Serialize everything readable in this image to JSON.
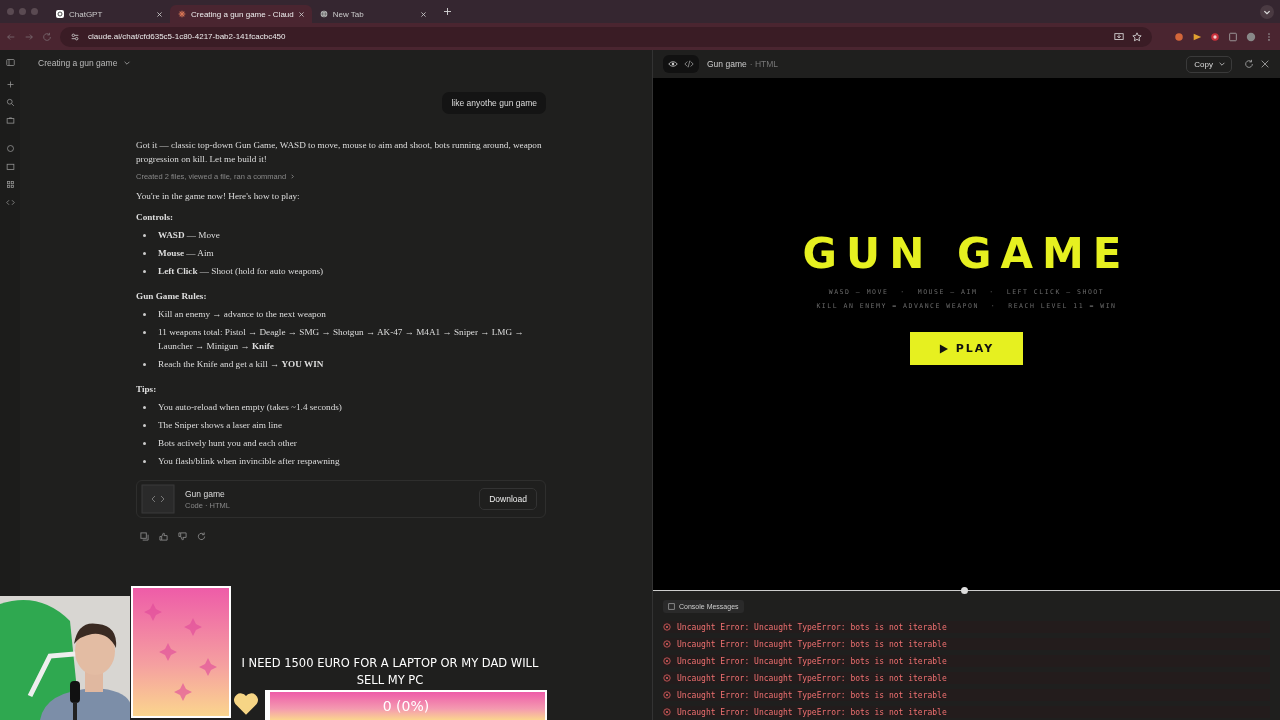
{
  "browser": {
    "tabs": [
      {
        "label": "ChatGPT",
        "kind": "chatgpt",
        "selected": false
      },
      {
        "label": "Creating a gun game - Claud",
        "kind": "claude",
        "selected": true
      },
      {
        "label": "New Tab",
        "kind": "globe",
        "selected": false
      }
    ],
    "url": "claude.ai/chat/cfd635c5-1c80-4217-bab2-141fcacbc450"
  },
  "chat": {
    "title": "Creating a gun game",
    "user_message": "like anyothe gun game",
    "intro": "Got it — classic top-down Gun Game, WASD to move, mouse to aim and shoot, bots running around, weapon progression on kill. Let me build it!",
    "tool_summary": "Created 2 files, viewed a file, ran a command",
    "lead": "You're in the game now! Here's how to play:",
    "sections": [
      {
        "heading": "Controls:",
        "items": [
          "**WASD** — Move",
          "**Mouse** — Aim",
          "**Left Click** — Shoot (hold for auto weapons)"
        ]
      },
      {
        "heading": "Gun Game Rules:",
        "items": [
          "Kill an enemy → advance to the next weapon",
          "11 weapons total: Pistol → Deagle → SMG → Shotgun → AK-47 → M4A1 → Sniper → LMG → Launcher → Minigun → **Knife**",
          "Reach the Knife and get a kill → **YOU WIN**"
        ]
      },
      {
        "heading": "Tips:",
        "items": [
          "You auto-reload when empty (takes ~1.4 seconds)",
          "The Sniper shows a laser aim line",
          "Bots actively hunt you and each other",
          "You flash/blink when invincible after respawning"
        ]
      }
    ],
    "artifact": {
      "title": "Gun game",
      "subtitle": "Code · HTML",
      "button": "Download"
    }
  },
  "preview": {
    "title": "Gun game",
    "type": "· HTML",
    "copy_button": "Copy",
    "game": {
      "title": "GUN GAME",
      "hints": [
        [
          "WASD — MOVE",
          "·",
          "MOUSE — AIM",
          "·",
          "LEFT CLICK — SHOOT"
        ],
        [
          "KILL AN ENEMY = ADVANCE WEAPON",
          "·",
          "REACH LEVEL 11 = WIN"
        ]
      ],
      "play_button": "PLAY"
    },
    "console": {
      "title": "Console Messages",
      "errors": [
        "Uncaught Error: Uncaught TypeError: bots is not iterable",
        "Uncaught Error: Uncaught TypeError: bots is not iterable",
        "Uncaught Error: Uncaught TypeError: bots is not iterable",
        "Uncaught Error: Uncaught TypeError: bots is not iterable",
        "Uncaught Error: Uncaught TypeError: bots is not iterable",
        "Uncaught Error: Uncaught TypeError: bots is not iterable"
      ]
    }
  },
  "overlay": {
    "goal_text": "I NEED 1500 EURO FOR A LAPTOP OR MY DAD WILL SELL MY PC",
    "goal_amount": "0 (0%)",
    "level": 0
  }
}
